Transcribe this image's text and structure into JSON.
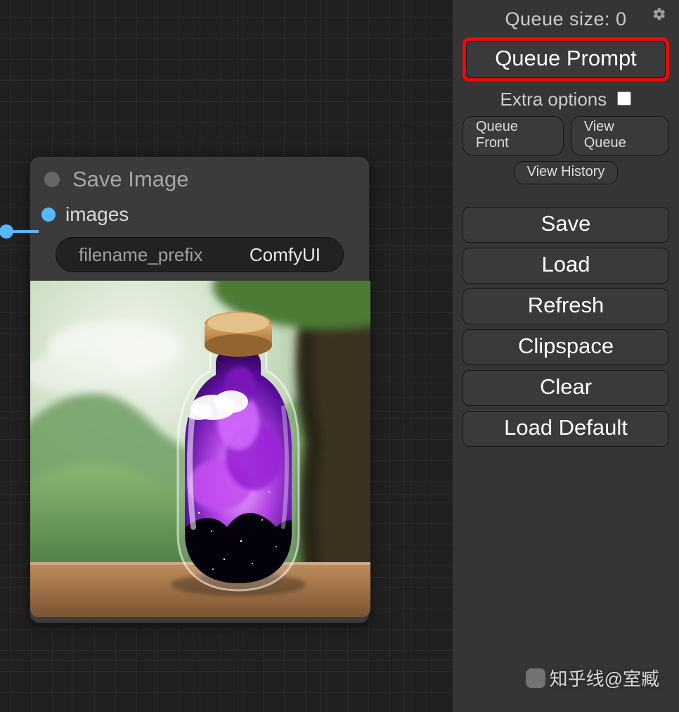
{
  "sidebar": {
    "queue_size_label": "Queue size: 0",
    "queue_prompt": "Queue Prompt",
    "extra_options_label": "Extra options",
    "queue_front": "Queue Front",
    "view_queue": "View Queue",
    "view_history": "View History",
    "buttons": {
      "save": "Save",
      "load": "Load",
      "refresh": "Refresh",
      "clipspace": "Clipspace",
      "clear": "Clear",
      "load_default": "Load Default"
    }
  },
  "node": {
    "title": "Save Image",
    "input_label": "images",
    "field_label": "filename_prefix",
    "field_value": "ComfyUI"
  },
  "watermark": "知乎线@室臧"
}
